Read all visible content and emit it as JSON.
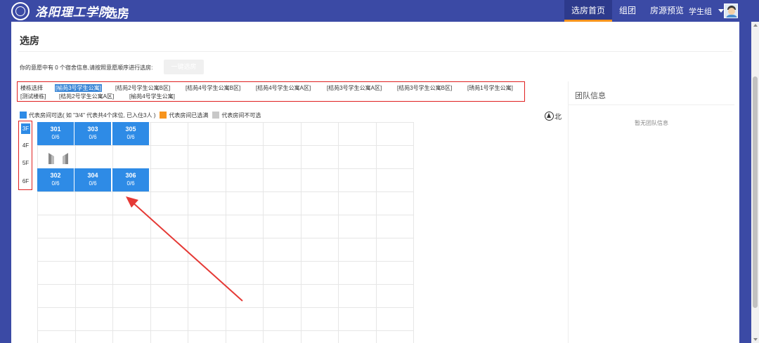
{
  "header": {
    "school_name": "洛阳理工学院",
    "app_title": "选房",
    "nav": [
      "选房首页",
      "组团",
      "房源预览"
    ],
    "active_nav": 0,
    "user_name": "学生组",
    "bg_color": "#3b4aa5",
    "accent_color": "#f7941d"
  },
  "page": {
    "title": "选房",
    "intention_text": "你的意愿中有 0 个宿舍信息,请按照意愿顺序进行选房:",
    "one_click_button": "一键选房"
  },
  "buildings": {
    "label": "楼栋选择",
    "items": [
      "[榆苑3号学生公寓]",
      "[桔苑2号学生公寓B区]",
      "[桔苑4号学生公寓B区]",
      "[桔苑4号学生公寓A区]",
      "[桔苑3号学生公寓A区]",
      "[桔苑3号学生公寓B区]",
      "[琇苑1号学生公寓]",
      "[测试楼栋]",
      "[桔苑2号学生公寓A区]",
      "[榆苑4号学生公寓]"
    ],
    "selected": 0
  },
  "legend": {
    "available": "代表房间可选( 如 \"3/4\" 代表共4个床位, 已入住3人 )",
    "full": "代表房间已选满",
    "unavailable": "代表房间不可选",
    "available_color": "#2e8be6",
    "full_color": "#f7941d",
    "unavailable_color": "#c8c8c8"
  },
  "floors": {
    "items": [
      "3F",
      "4F",
      "5F",
      "6F"
    ],
    "selected": 0
  },
  "rooms": {
    "top": [
      {
        "no": "301",
        "beds": "0/6"
      },
      {
        "no": "303",
        "beds": "0/6"
      },
      {
        "no": "305",
        "beds": "0/6"
      }
    ],
    "bottom": [
      {
        "no": "302",
        "beds": "0/6"
      },
      {
        "no": "304",
        "beds": "0/6"
      },
      {
        "no": "306",
        "beds": "0/6"
      }
    ]
  },
  "compass_label": "北",
  "team": {
    "title": "团队信息",
    "empty_text": "暂无团队信息"
  },
  "icons": {
    "logo": "school-seal-icon",
    "compass": "north-compass-icon",
    "stairs": "stairs-icon",
    "user_caret": "caret-down-icon",
    "avatar": "student-avatar-icon"
  }
}
